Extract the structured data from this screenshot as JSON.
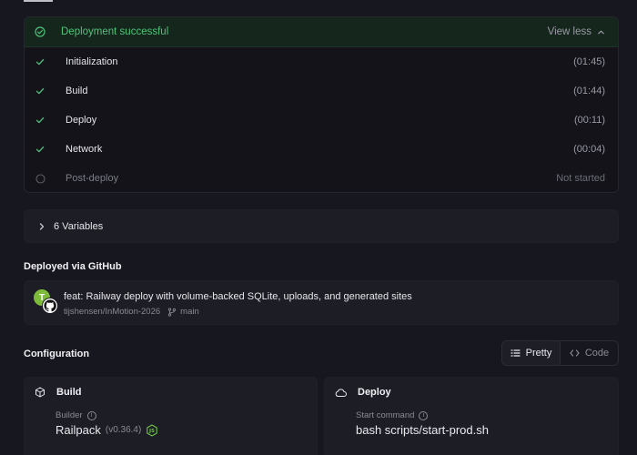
{
  "deployment": {
    "status_text": "Deployment successful",
    "toggle_label": "View less",
    "steps": [
      {
        "label": "Initialization",
        "time": "(01:45)",
        "done": true
      },
      {
        "label": "Build",
        "time": "(01:44)",
        "done": true
      },
      {
        "label": "Deploy",
        "time": "(00:11)",
        "done": true
      },
      {
        "label": "Network",
        "time": "(00:04)",
        "done": true
      },
      {
        "label": "Post-deploy",
        "time": "Not started",
        "done": false
      }
    ]
  },
  "variables": {
    "label": "6 Variables"
  },
  "github": {
    "section_title": "Deployed via GitHub",
    "avatar_initial": "T",
    "commit_message": "feat: Railway deploy with volume-backed SQLite, uploads, and generated sites",
    "repo": "tijshensen/InMotion-2026",
    "branch": "main"
  },
  "configuration": {
    "section_title": "Configuration",
    "view_options": [
      "Pretty",
      "Code"
    ],
    "selected_view": "Pretty",
    "build": {
      "title": "Build",
      "field_label": "Builder",
      "value": "Railpack",
      "version": "(v0.36.4)"
    },
    "deploy": {
      "title": "Deploy",
      "field_label": "Start command",
      "value": "bash scripts/start-prod.sh"
    }
  },
  "colors": {
    "success": "#4fc37a",
    "background": "#17171f",
    "card": "#1d1d25"
  },
  "icons": {
    "status": "check-circle-icon",
    "step_done": "check-icon",
    "step_pending": "circle-icon",
    "view_less": "chevron-up-icon",
    "variables": "chevron-right-icon",
    "github": "github-icon",
    "branch": "git-branch-icon",
    "pretty": "list-icon",
    "code": "code-icon",
    "build": "package-icon",
    "deploy": "cloud-icon",
    "info": "info-icon",
    "node": "nodejs-icon"
  }
}
